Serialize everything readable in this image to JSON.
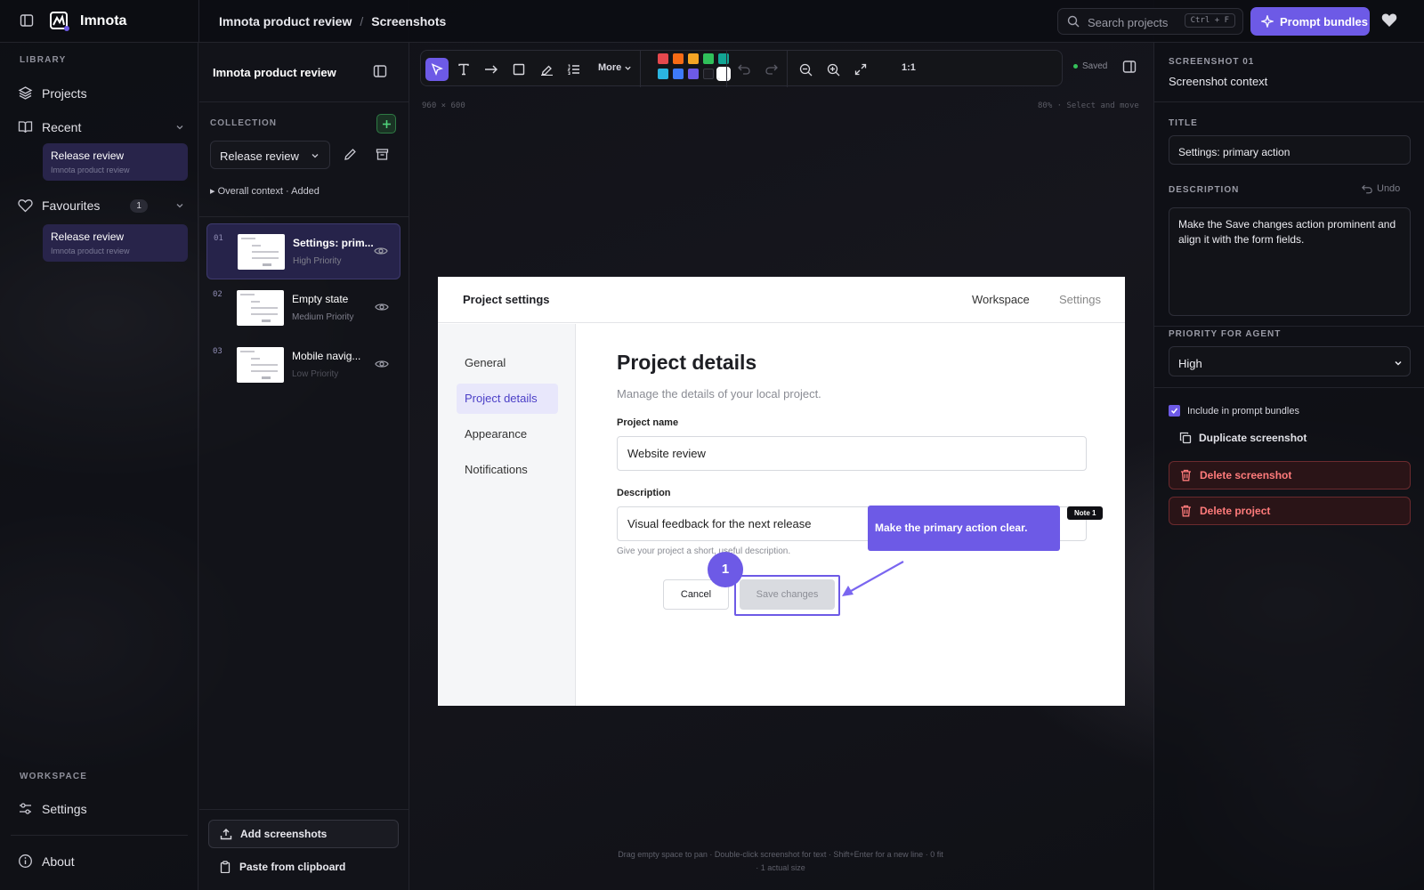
{
  "app": {
    "name": "Imnota"
  },
  "header": {
    "project": "Imnota product review",
    "separator": "/",
    "section": "Screenshots",
    "search": {
      "placeholder": "Search projects",
      "shortcut": "Ctrl + F"
    },
    "prompt_bundles_label": "Prompt bundles"
  },
  "sidebar": {
    "library_label": "LIBRARY",
    "projects_label": "Projects",
    "recent_label": "Recent",
    "recent_items": [
      {
        "title": "Release review",
        "subtitle": "Imnota product review"
      }
    ],
    "favourites_label": "Favourites",
    "favourites_count": "1",
    "favourite_items": [
      {
        "title": "Release review",
        "subtitle": "Imnota product review"
      }
    ],
    "workspace_label": "WORKSPACE",
    "settings_label": "Settings",
    "about_label": "About"
  },
  "collection": {
    "project_title": "Imnota product review",
    "label": "COLLECTION",
    "selected": "Release review",
    "overall_context": "Overall context · Added",
    "screenshots": [
      {
        "num": "01",
        "title": "Settings: prim...",
        "priority": "High Priority"
      },
      {
        "num": "02",
        "title": "Empty state",
        "priority": "Medium Priority"
      },
      {
        "num": "03",
        "title": "Mobile navig...",
        "priority": "Low Priority"
      }
    ],
    "add_label": "Add screenshots",
    "paste_label": "Paste from clipboard"
  },
  "canvas": {
    "more_label": "More",
    "zoom_actual": "1:1",
    "saved_label": "Saved",
    "dimensions": "960 × 600",
    "mode": "80% · Select and move",
    "hint_line1": "Drag empty space to pan · Double-click screenshot for text · Shift+Enter for a new line · 0 fit",
    "hint_line2": "· 1 actual size",
    "swatches": [
      "#e5484d",
      "#f76b15",
      "#f5a524",
      "#30c05a",
      "#12a594",
      "#2bb5e0",
      "#3e7bfa",
      "#6d5ae6",
      "#1c1c22",
      "#ffffff"
    ]
  },
  "screenshot": {
    "app_title": "Project settings",
    "top_links": [
      "Workspace",
      "Settings"
    ],
    "nav": [
      "General",
      "Project details",
      "Appearance",
      "Notifications"
    ],
    "heading": "Project details",
    "subheading": "Manage the details of your local project.",
    "name_label": "Project name",
    "name_value": "Website review",
    "desc_label": "Description",
    "desc_value": "Visual feedback for the next release",
    "help": "Give your project a short, useful description.",
    "cancel": "Cancel",
    "save": "Save changes"
  },
  "annotation": {
    "number": "1",
    "note": "Make the primary action clear.",
    "tag": "Note 1"
  },
  "details": {
    "eyebrow": "SCREENSHOT 01",
    "heading": "Screenshot context",
    "title_label": "TITLE",
    "title_value": "Settings: primary action",
    "description_label": "DESCRIPTION",
    "undo_label": "Undo",
    "description_value": "Make the Save changes action prominent and align it with the form fields.",
    "priority_label": "PRIORITY FOR AGENT",
    "priority_value": "High",
    "include_label": "Include in prompt bundles",
    "duplicate_label": "Duplicate screenshot",
    "delete_screenshot_label": "Delete screenshot",
    "delete_project_label": "Delete project"
  },
  "colors": {
    "accent": "#6d5ae6",
    "danger": "#ff7b7b",
    "success": "#35c15a"
  }
}
